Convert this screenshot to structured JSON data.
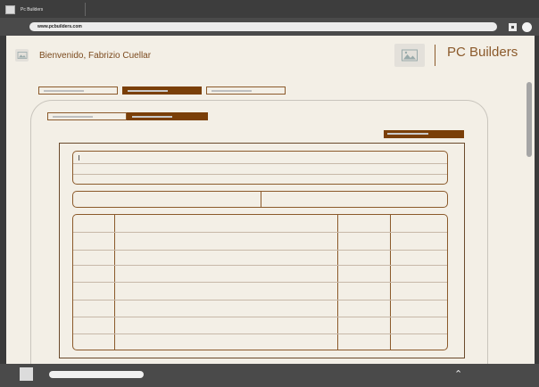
{
  "tab": {
    "title": "Pc Builders"
  },
  "address_bar": {
    "url": "www.pcbuilders.com"
  },
  "header": {
    "welcome": "Bienvenido, Fabrizio Cuellar",
    "brand": "PC Builders"
  },
  "icons": {
    "favicon": "image-placeholder-icon",
    "profile": "image-placeholder-icon",
    "logo": "image-placeholder-icon",
    "extensions": "window-icon",
    "account": "circle-avatar-icon",
    "scroll_up": "chevron-up-icon"
  },
  "bottom_bar": {
    "chevron": "⌃"
  },
  "colors": {
    "accent": "#7a3f08",
    "border": "#8b5a2b",
    "page_bg": "#f3efe6",
    "chrome": "#3d3d3d"
  }
}
